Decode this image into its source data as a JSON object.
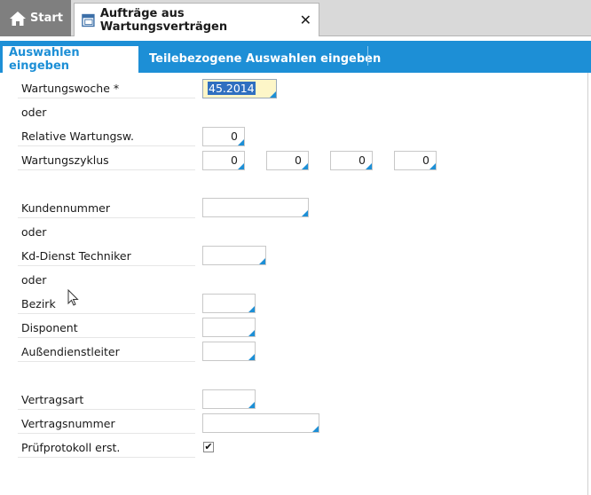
{
  "tabs": {
    "start_label": "Start",
    "document_label": "Aufträge aus Wartungsverträgen"
  },
  "subtabs": [
    {
      "label": "Auswahlen eingeben",
      "active": true
    },
    {
      "label": "Teilebezogene Auswahlen eingeben",
      "active": false
    }
  ],
  "form": {
    "wartungswoche": {
      "label": "Wartungswoche *",
      "value": "45.2014"
    },
    "oder1": "oder",
    "relative": {
      "label": "Relative Wartungsw.",
      "value": "0"
    },
    "zyklus": {
      "label": "Wartungszyklus",
      "values": [
        "0",
        "0",
        "0",
        "0"
      ]
    },
    "kundennummer": {
      "label": "Kundennummer",
      "value": ""
    },
    "oder2": "oder",
    "techniker": {
      "label": "Kd-Dienst Techniker",
      "value": ""
    },
    "oder3": "oder",
    "bezirk": {
      "label": "Bezirk",
      "value": ""
    },
    "disponent": {
      "label": "Disponent",
      "value": ""
    },
    "aussendienst": {
      "label": "Außendienstleiter",
      "value": ""
    },
    "vertragsart": {
      "label": "Vertragsart",
      "value": ""
    },
    "vertragsnummer": {
      "label": "Vertragsnummer",
      "value": ""
    },
    "pruefprotokoll": {
      "label": "Prüfprotokoll erst.",
      "checked": true,
      "mark": "✔"
    }
  },
  "colors": {
    "accent": "#1d8fd6",
    "field_active": "#fdf6c8",
    "selection": "#2f6fc0"
  }
}
